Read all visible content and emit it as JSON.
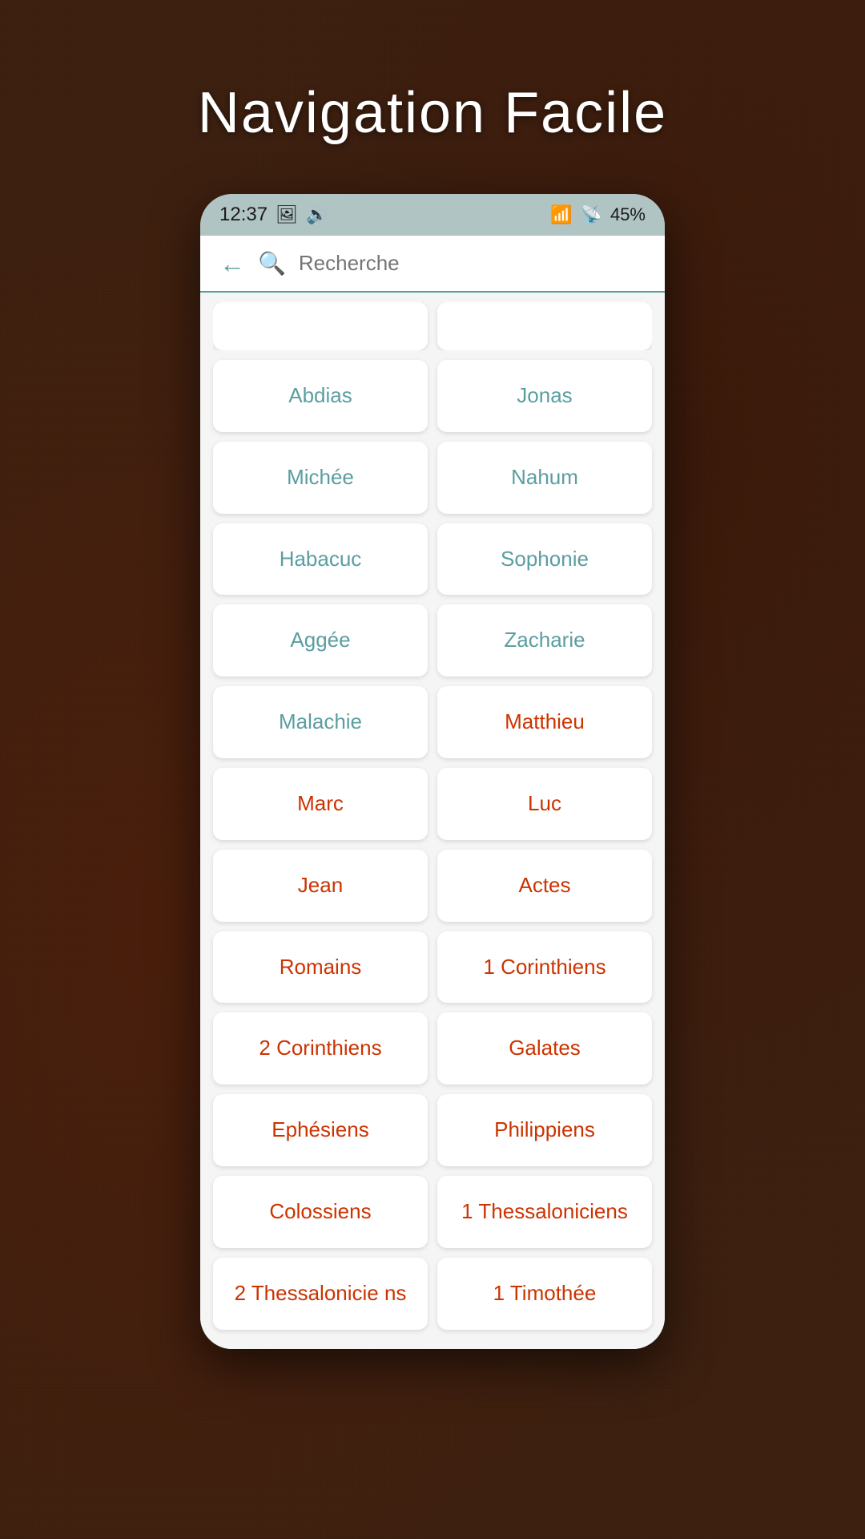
{
  "page": {
    "title": "Navigation Facile",
    "background_color": "#3d2010"
  },
  "status_bar": {
    "time": "12:37",
    "battery": "45%",
    "icons": [
      "🖼",
      "🎵",
      "📶"
    ]
  },
  "search": {
    "placeholder": "Recherche",
    "back_icon": "←",
    "search_icon": "🔍"
  },
  "books": [
    {
      "id": "row0",
      "left": {
        "label": "",
        "nt": false
      },
      "right": {
        "label": "",
        "nt": false
      },
      "partial_top": true
    },
    {
      "id": "row1",
      "left": {
        "label": "Abdias",
        "nt": false
      },
      "right": {
        "label": "Jonas",
        "nt": false
      }
    },
    {
      "id": "row2",
      "left": {
        "label": "Michée",
        "nt": false
      },
      "right": {
        "label": "Nahum",
        "nt": false
      }
    },
    {
      "id": "row3",
      "left": {
        "label": "Habacuc",
        "nt": false
      },
      "right": {
        "label": "Sophonie",
        "nt": false
      }
    },
    {
      "id": "row4",
      "left": {
        "label": "Aggée",
        "nt": false
      },
      "right": {
        "label": "Zacharie",
        "nt": false
      }
    },
    {
      "id": "row5",
      "left": {
        "label": "Malachie",
        "nt": false
      },
      "right": {
        "label": "Matthieu",
        "nt": true
      }
    },
    {
      "id": "row6",
      "left": {
        "label": "Marc",
        "nt": true
      },
      "right": {
        "label": "Luc",
        "nt": true
      }
    },
    {
      "id": "row7",
      "left": {
        "label": "Jean",
        "nt": true
      },
      "right": {
        "label": "Actes",
        "nt": true
      }
    },
    {
      "id": "row8",
      "left": {
        "label": "Romains",
        "nt": true
      },
      "right": {
        "label": "1 Corinthiens",
        "nt": true
      }
    },
    {
      "id": "row9",
      "left": {
        "label": "2 Corinthiens",
        "nt": true
      },
      "right": {
        "label": "Galates",
        "nt": true
      }
    },
    {
      "id": "row10",
      "left": {
        "label": "Ephésiens",
        "nt": true
      },
      "right": {
        "label": "Philippiens",
        "nt": true
      }
    },
    {
      "id": "row11",
      "left": {
        "label": "Colossiens",
        "nt": true
      },
      "right": {
        "label": "1 Thessaloniciens",
        "nt": true
      }
    },
    {
      "id": "row12",
      "left": {
        "label": "2 Thessalonicie ns",
        "nt": true
      },
      "right": {
        "label": "1 Timothée",
        "nt": true
      },
      "partial_bottom": true
    }
  ]
}
